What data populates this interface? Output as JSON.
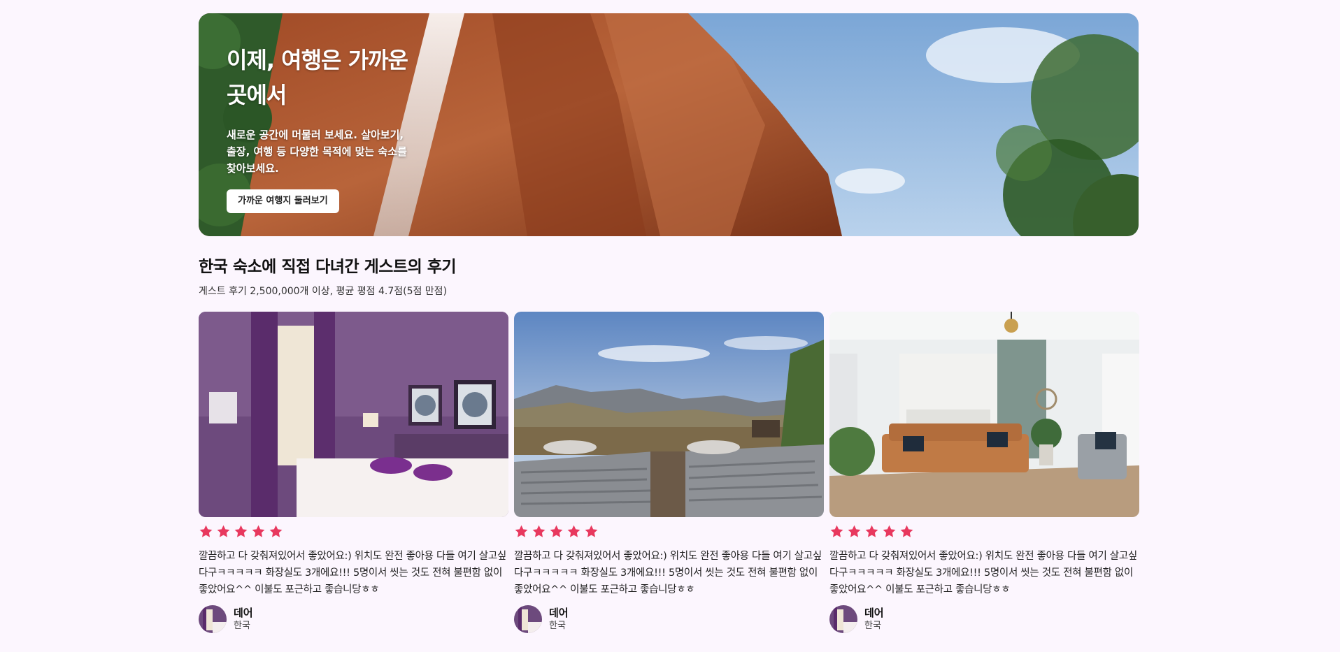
{
  "hero": {
    "title": "이제, 여행은 가까운 곳에서",
    "subtitle": "새로운 공간에 머물러 보세요. 살아보기, 출장, 여행 등 다양한 목적에 맞는 숙소를 찾아보세요.",
    "button_label": "가까운 여행지 둘러보기"
  },
  "section": {
    "title": "한국 숙소에 직접 다녀간 게스트의 후기",
    "subtitle": "게스트 후기 2,500,000개 이상, 평균 평점 4.7점(5점 만점)"
  },
  "colors": {
    "star": "#e8385e",
    "background": "#fcf6fe"
  },
  "reviews": [
    {
      "image": "bedroom-photo",
      "rating": 5,
      "text": "깔끔하고 다 갖춰져있어서 좋았어요:) 위치도 완전 좋아용 다들 여기 살고싶다구ㅋㅋㅋㅋㅋ 화장실도 3개에요!!! 5명이서 씻는 것도 전혀 불편함 없이 좋았어요^^ 이불도 포근하고 좋습니당ㅎㅎ",
      "author": "데어",
      "location": "한국"
    },
    {
      "image": "mountain-view-photo",
      "rating": 5,
      "text": "깔끔하고 다 갖춰져있어서 좋았어요:) 위치도 완전 좋아용 다들 여기 살고싶다구ㅋㅋㅋㅋㅋ 화장실도 3개에요!!! 5명이서 씻는 것도 전혀 불편함 없이 좋았어요^^ 이불도 포근하고 좋습니당ㅎㅎ",
      "author": "데어",
      "location": "한국"
    },
    {
      "image": "living-room-photo",
      "rating": 5,
      "text": "깔끔하고 다 갖춰져있어서 좋았어요:) 위치도 완전 좋아용 다들 여기 살고싶다구ㅋㅋㅋㅋㅋ 화장실도 3개에요!!! 5명이서 씻는 것도 전혀 불편함 없이 좋았어요^^ 이불도 포근하고 좋습니당ㅎㅎ",
      "author": "데어",
      "location": "한국"
    }
  ]
}
